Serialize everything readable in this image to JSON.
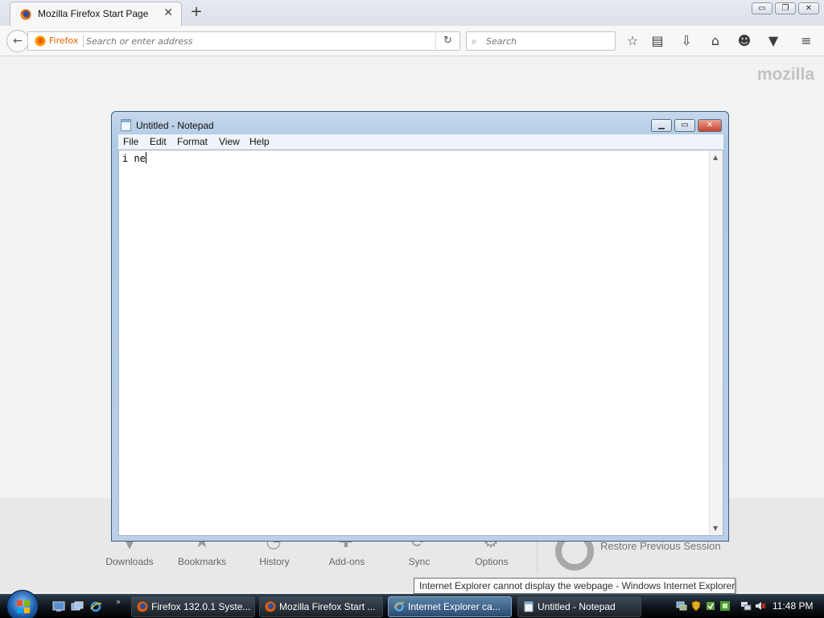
{
  "firefox": {
    "tab_title": "Mozilla Firefox Start Page",
    "tab_close": "✕",
    "new_tab": "+",
    "window_controls": {
      "minimize": "▭",
      "maximize": "❐",
      "close": "✕"
    },
    "identity_label": "Firefox",
    "url_placeholder": "Search or enter address",
    "search_placeholder": "Search",
    "reload": "↻",
    "back": "←",
    "toolbar_icons": [
      "star-icon",
      "reading-list-icon",
      "downloads-icon",
      "home-icon",
      "hello-icon",
      "pocket-icon",
      "menu-icon"
    ]
  },
  "start_page": {
    "logo": "mozilla",
    "launcher": [
      {
        "label": "Downloads",
        "icon": "downloads-icon"
      },
      {
        "label": "Bookmarks",
        "icon": "bookmarks-icon"
      },
      {
        "label": "History",
        "icon": "history-icon"
      },
      {
        "label": "Add-ons",
        "icon": "addons-icon"
      },
      {
        "label": "Sync",
        "icon": "sync-icon"
      },
      {
        "label": "Options",
        "icon": "options-icon"
      }
    ],
    "restore_session": "Restore Previous Session"
  },
  "notepad": {
    "title": "Untitled - Notepad",
    "menus": [
      "File",
      "Edit",
      "Format",
      "View",
      "Help"
    ],
    "text": "i ne",
    "controls": {
      "minimize": "▁",
      "maximize": "▭",
      "close": "✕"
    }
  },
  "tooltip": "Internet Explorer cannot display the webpage - Windows Internet Explorer",
  "taskbar": {
    "quick_launch_more": "»",
    "tasks": [
      {
        "label": "Firefox 132.0.1 Syste...",
        "icon": "firefox-icon",
        "active": false
      },
      {
        "label": "Mozilla Firefox Start ...",
        "icon": "firefox-icon",
        "active": false
      },
      {
        "label": "Internet Explorer ca...",
        "icon": "ie-icon",
        "active": true
      },
      {
        "label": "Untitled - Notepad",
        "icon": "notepad-icon",
        "active": false
      }
    ],
    "clock": "11:48 PM"
  }
}
